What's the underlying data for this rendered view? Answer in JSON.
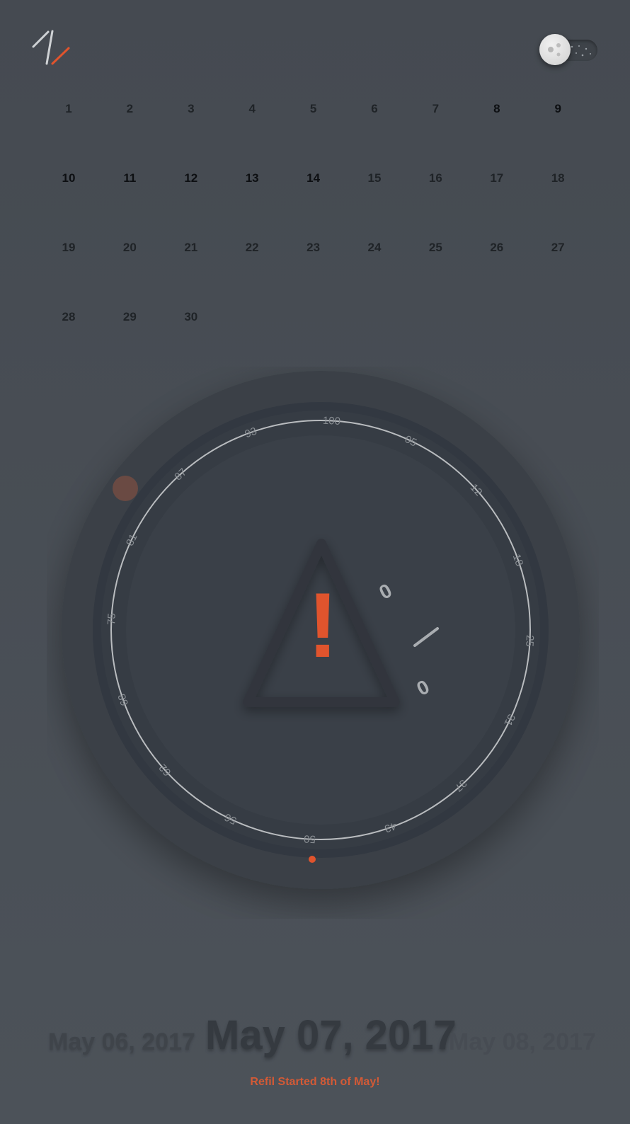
{
  "header": {
    "logo_icon": "slashes-logo",
    "theme_toggle_icon": "moon-toggle",
    "accent_color": "#e0542d"
  },
  "calendar": {
    "days": [
      {
        "label": "1"
      },
      {
        "label": "2"
      },
      {
        "label": "3"
      },
      {
        "label": "4"
      },
      {
        "label": "5"
      },
      {
        "label": "6"
      },
      {
        "label": "7"
      },
      {
        "label": "8"
      },
      {
        "label": "9"
      },
      {
        "label": "10"
      },
      {
        "label": "11"
      },
      {
        "label": "12"
      },
      {
        "label": "13"
      },
      {
        "label": "14"
      },
      {
        "label": "15"
      },
      {
        "label": "16"
      },
      {
        "label": "17"
      },
      {
        "label": "18"
      },
      {
        "label": "19"
      },
      {
        "label": "20"
      },
      {
        "label": "21"
      },
      {
        "label": "22"
      },
      {
        "label": "23"
      },
      {
        "label": "24"
      },
      {
        "label": "25"
      },
      {
        "label": "26"
      },
      {
        "label": "27"
      },
      {
        "label": "28"
      },
      {
        "label": "29"
      },
      {
        "label": "30"
      }
    ]
  },
  "gauge": {
    "ticks": [
      "100",
      "05",
      "12",
      "18",
      "25",
      "31",
      "37",
      "43",
      "50",
      "56",
      "62",
      "68",
      "75",
      "81",
      "87",
      "93"
    ],
    "center_readout": "0/0",
    "warning_icon": "warning-triangle-icon",
    "warning_mark": "!",
    "readout_top": "0",
    "readout_bottom": "0"
  },
  "dates": {
    "previous": "May 06, 2017",
    "current": "May 07, 2017",
    "next": "May 08, 2017"
  },
  "status": {
    "message": "Refil Started 8th of May!"
  }
}
